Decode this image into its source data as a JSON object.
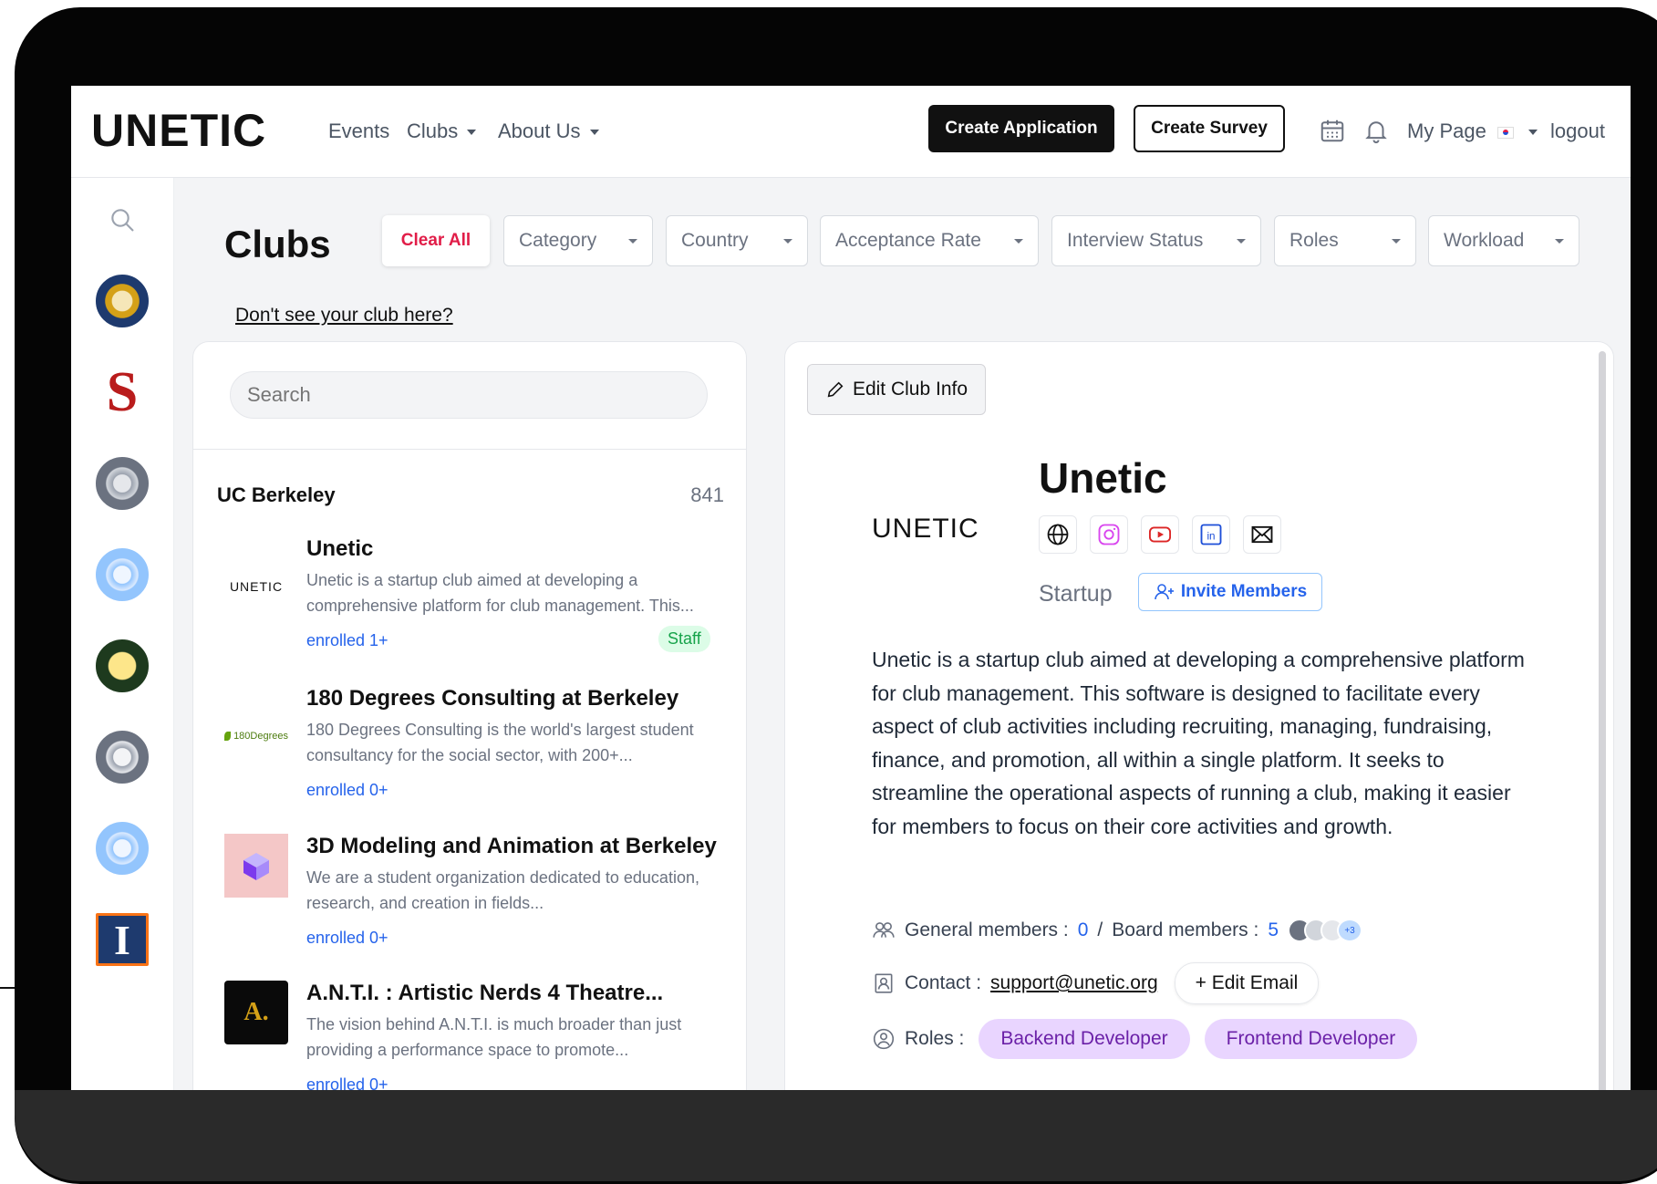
{
  "nav": {
    "logo": "UNETIC",
    "links": [
      "Events",
      "Clubs",
      "About Us"
    ],
    "create_application": "Create Application",
    "create_survey": "Create Survey",
    "my_page": "My Page",
    "logout": "logout"
  },
  "header": {
    "title": "Clubs",
    "clear_all": "Clear All",
    "filters": [
      "Category",
      "Country",
      "Acceptance Rate",
      "Interview Status",
      "Roles",
      "Workload"
    ],
    "dont_see": "Don't see your club here?"
  },
  "list": {
    "search_placeholder": "Search",
    "school": "UC Berkeley",
    "count": "841",
    "clubs": [
      {
        "name": "Unetic",
        "thumb_text": "UNETIC",
        "desc": "Unetic is a startup club aimed at developing a comprehensive platform for club management. This...",
        "enrolled": "enrolled 1+",
        "badge": "Staff"
      },
      {
        "name": "180 Degrees Consulting at Berkeley",
        "thumb_text": "180Degrees",
        "desc": "180 Degrees Consulting is the world's largest student consultancy for the social sector, with 200+...",
        "enrolled": "enrolled 0+",
        "badge": ""
      },
      {
        "name": "3D Modeling and Animation at Berkeley",
        "thumb_text": "",
        "desc": "We are a student organization dedicated to education, research, and creation in fields...",
        "enrolled": "enrolled 0+",
        "badge": ""
      },
      {
        "name": "A.N.T.I. : Artistic Nerds 4 Theatre...",
        "thumb_text": "A.",
        "desc": "The vision behind A.N.T.I. is much broader than just providing a performance space to promote...",
        "enrolled": "enrolled 0+",
        "badge": ""
      }
    ]
  },
  "detail": {
    "edit_label": "Edit Club Info",
    "logo": "UNETIC",
    "name": "Unetic",
    "category": "Startup",
    "invite": "Invite Members",
    "description": "Unetic is a startup club aimed at developing a comprehensive platform for club management. This software is designed to facilitate every aspect of club activities including recruiting, managing, fundraising, finance, and promotion, all within a single platform. It seeks to streamline the operational aspects of running a club, making it easier for members to focus on their core activities and growth.",
    "general_label": "General members :",
    "general_count": "0",
    "separator": "/",
    "board_label": "Board members :",
    "board_count": "5",
    "avatar_more": "+3",
    "contact_label": "Contact :",
    "contact_email": "support@unetic.org",
    "edit_email": "+ Edit Email",
    "roles_label": "Roles :",
    "roles": [
      "Backend Developer",
      "Frontend Developer"
    ]
  },
  "colors": {
    "accent_blue": "#2563eb",
    "clear_red": "#e11d48",
    "staff_green": "#16a34a",
    "role_purple": "#e9d5ff"
  }
}
